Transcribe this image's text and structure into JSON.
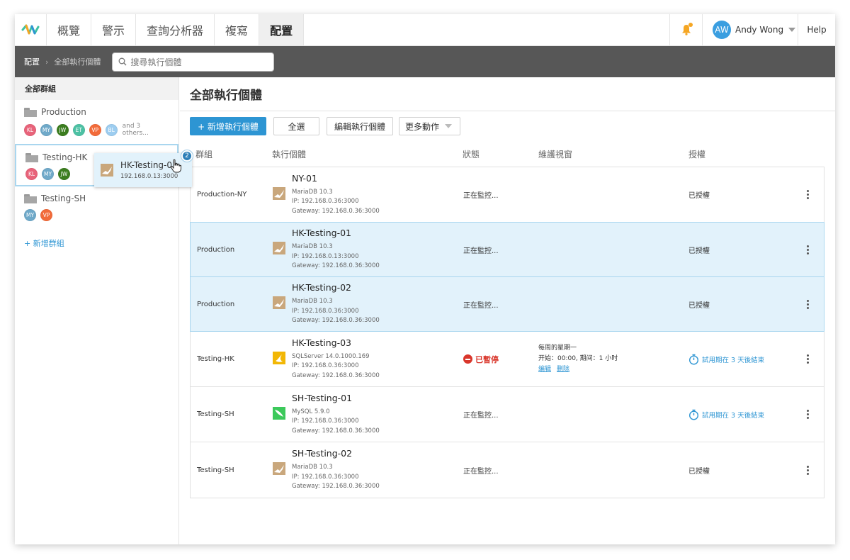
{
  "nav": {
    "tabs": [
      "概覽",
      "警示",
      "查詢分析器",
      "複寫",
      "配置"
    ],
    "active_tab": "配置",
    "user_initials": "AW",
    "user_name": "Andy Wong",
    "help": "Help"
  },
  "breadcrumb": {
    "root": "配置",
    "current": "全部執行個體"
  },
  "search": {
    "placeholder": "搜尋執行個體"
  },
  "sidebar": {
    "heading": "全部群組",
    "groups": [
      {
        "name": "Production",
        "members": [
          {
            "initials": "KL",
            "color": "#e8637a"
          },
          {
            "initials": "MY",
            "color": "#6fa9c9"
          },
          {
            "initials": "JW",
            "color": "#3b7d1f"
          },
          {
            "initials": "ET",
            "color": "#4dc1a4"
          },
          {
            "initials": "VP",
            "color": "#f26b3a"
          },
          {
            "initials": "BL",
            "color": "#9dcdf0"
          }
        ],
        "others": "and 3 others..."
      },
      {
        "name": "Testing-HK",
        "members": [
          {
            "initials": "KL",
            "color": "#e8637a"
          },
          {
            "initials": "MY",
            "color": "#6fa9c9"
          },
          {
            "initials": "JW",
            "color": "#3b7d1f"
          }
        ]
      },
      {
        "name": "Testing-SH",
        "members": [
          {
            "initials": "MY",
            "color": "#6fa9c9"
          },
          {
            "initials": "VP",
            "color": "#f26b3a"
          }
        ]
      }
    ],
    "add_group": "+ 新增群組"
  },
  "drag_ghost": {
    "name": "HK-Testing-01",
    "ip": "192.168.0.13:3000",
    "count": "2"
  },
  "main": {
    "title": "全部執行個體",
    "toolbar": {
      "add": "+ 新增執行個體",
      "select_all": "全選",
      "edit": "編輯執行個體",
      "more": "更多動作"
    },
    "columns": [
      "群組",
      "執行個體",
      "狀態",
      "維護視窗",
      "授權"
    ],
    "rows": [
      {
        "group": "Production-NY",
        "name": "NY-01",
        "db": "MariaDB 10.3",
        "db_type": "mariadb",
        "ip": "IP: 192.168.0.36:3000",
        "gateway": "Gateway: 192.168.0.36:3000",
        "status": "正在監控...",
        "license": "已授權",
        "highlight": false
      },
      {
        "group": "Production",
        "name": "HK-Testing-01",
        "db": "MariaDB 10.3",
        "db_type": "mariadb",
        "ip": "IP: 192.168.0.13:3000",
        "gateway": "Gateway: 192.168.0.36:3000",
        "status": "正在監控...",
        "license": "已授權",
        "highlight": true
      },
      {
        "group": "Production",
        "name": "HK-Testing-02",
        "db": "MariaDB 10.3",
        "db_type": "mariadb",
        "ip": "IP: 192.168.0.36:3000",
        "gateway": "Gateway: 192.168.0.36:3000",
        "status": "正在監控...",
        "license": "已授權",
        "highlight": true
      },
      {
        "group": "Testing-HK",
        "name": "HK-Testing-03",
        "db": "SQLServer 14.0.1000.169",
        "db_type": "sqlserver",
        "ip": "IP: 192.168.0.36:3000",
        "gateway": "Gateway: 192.168.0.36:3000",
        "status": "已暫停",
        "status_paused": true,
        "maintenance": {
          "line1": "每周的星期一",
          "line2": "开始：00:00, 期间：1 小时",
          "edit": "编辑",
          "delete": "删除"
        },
        "license": "試用期在 3 天後結束",
        "license_trial": true,
        "highlight": false
      },
      {
        "group": "Testing-SH",
        "name": "SH-Testing-01",
        "db": "MySQL 5.9.0",
        "db_type": "mysql",
        "ip": "IP: 192.168.0.36:3000",
        "gateway": "Gateway: 192.168.0.36:3000",
        "status": "正在監控...",
        "license": "試用期在 3 天後結束",
        "license_trial": true,
        "highlight": false
      },
      {
        "group": "Testing-SH",
        "name": "SH-Testing-02",
        "db": "MariaDB 10.3",
        "db_type": "mariadb",
        "ip": "IP: 192.168.0.36:3000",
        "gateway": "Gateway: 192.168.0.36:3000",
        "status": "正在監控...",
        "license": "已授權",
        "highlight": false
      }
    ]
  },
  "colors": {
    "accent": "#2d95d3",
    "highlight_row": "#e2f2fb",
    "paused": "#d9362b",
    "breadcrumb_bar": "#575757"
  }
}
